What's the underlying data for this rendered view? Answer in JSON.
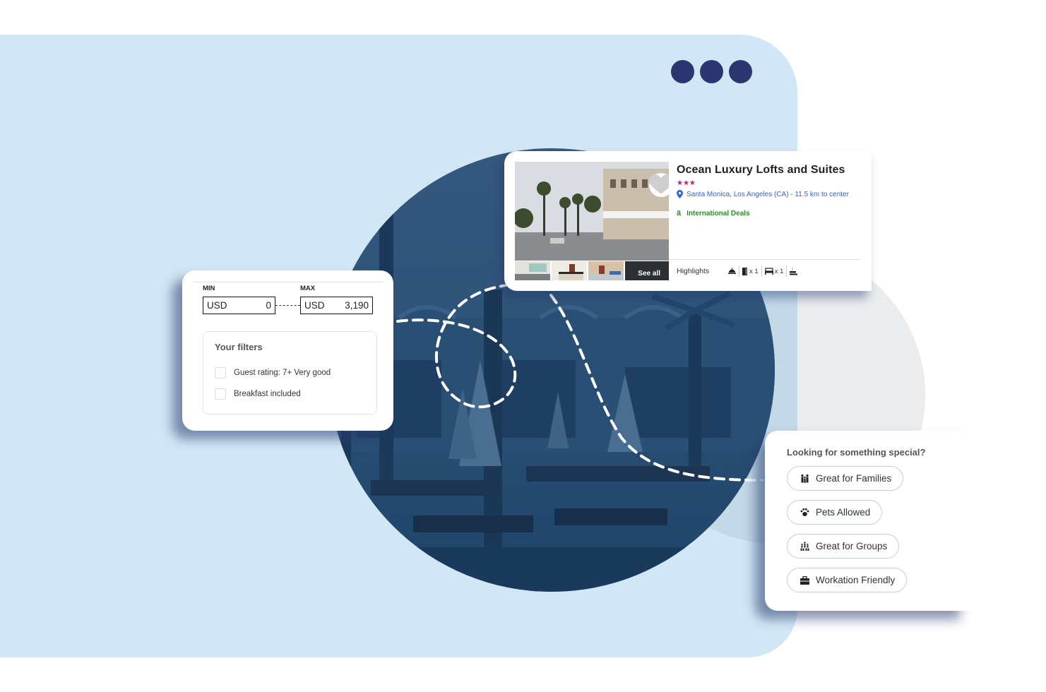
{
  "decoration": {
    "window_dots": 3,
    "accent_colors": {
      "panel_bg": "#d2e7f5",
      "dots": "#2b3671",
      "stars": "#d1186b",
      "location": "#2f63d9",
      "deals": "#2e8b2e"
    }
  },
  "hotel_card": {
    "name": "Ocean Luxury Lofts and Suites",
    "star_rating": 3,
    "stars_text": "★★★",
    "location_icon": "map-pin-icon",
    "location": "Santa Monica, Los Angeles (CA) - 11.5 km to center",
    "deal_icon": "deal-tag-icon",
    "deal": "International Deals",
    "favorite_icon": "heart-icon",
    "see_all_label": "See all",
    "highlights_label": "Highlights",
    "amenities": [
      {
        "icon": "hotel-bell-icon",
        "count": ""
      },
      {
        "icon": "door-icon",
        "count": "x 1"
      },
      {
        "icon": "bed-icon",
        "count": "x 1"
      },
      {
        "icon": "coffee-machine-icon",
        "count": ""
      }
    ]
  },
  "price_filter": {
    "min_label": "MIN",
    "max_label": "MAX",
    "min_currency": "USD",
    "min_value": "0",
    "max_currency": "USD",
    "max_value": "3,190"
  },
  "your_filters": {
    "title": "Your filters",
    "items": [
      {
        "label": "Guest rating: 7+ Very good",
        "checked": false
      },
      {
        "label": "Breakfast included",
        "checked": false
      }
    ]
  },
  "special": {
    "title": "Looking for something special?",
    "options": [
      {
        "label": "Great for Families",
        "icon": "family-icon"
      },
      {
        "label": "Pets Allowed",
        "icon": "paw-icon"
      },
      {
        "label": "Great for Groups",
        "icon": "group-icon"
      },
      {
        "label": "Workation Friendly",
        "icon": "briefcase-icon"
      }
    ]
  }
}
